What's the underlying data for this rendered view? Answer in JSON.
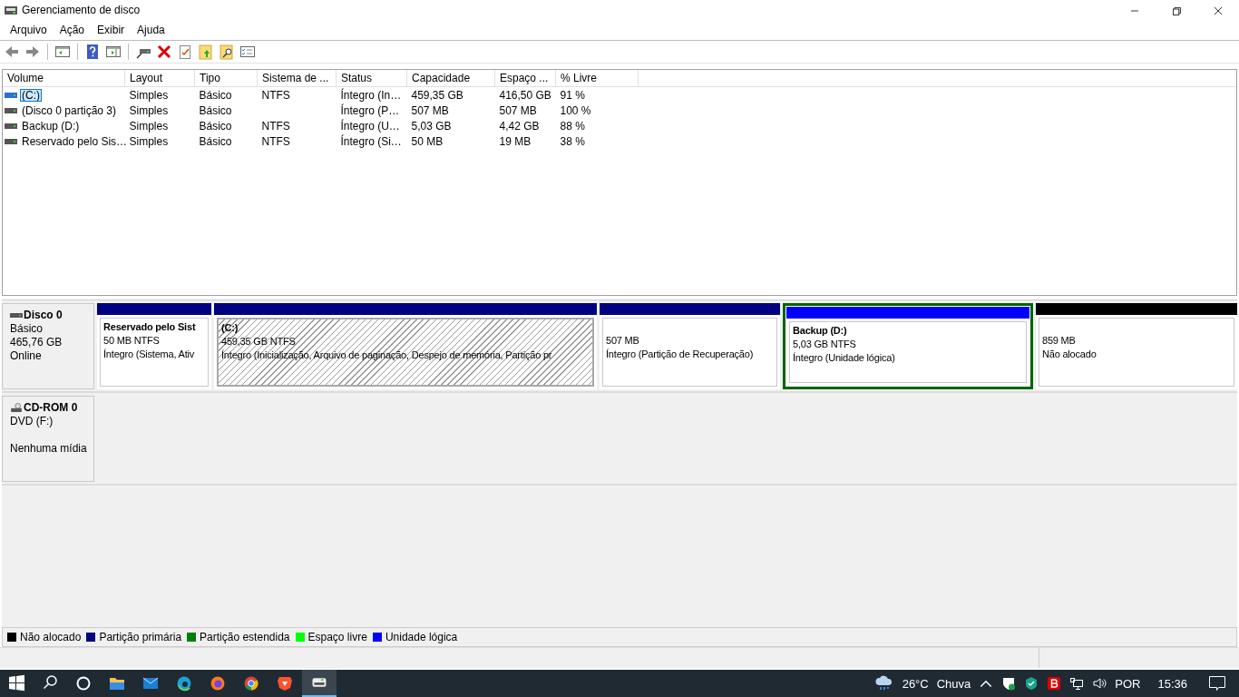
{
  "window": {
    "title": "Gerenciamento de disco"
  },
  "menu": [
    "Arquivo",
    "Ação",
    "Exibir",
    "Ajuda"
  ],
  "table": {
    "columns": [
      "Volume",
      "Layout",
      "Tipo",
      "Sistema de ...",
      "Status",
      "Capacidade",
      "Espaço ...",
      "% Livre"
    ],
    "rows": [
      {
        "selected": true,
        "cells": [
          "(C:)",
          "Simples",
          "Básico",
          "NTFS",
          "Íntegro (In…",
          "459,35 GB",
          "416,50 GB",
          "91 %"
        ]
      },
      {
        "selected": false,
        "cells": [
          "(Disco 0 partição 3)",
          "Simples",
          "Básico",
          "",
          "Íntegro (P…",
          "507 MB",
          "507 MB",
          "100 %"
        ]
      },
      {
        "selected": false,
        "cells": [
          "Backup (D:)",
          "Simples",
          "Básico",
          "NTFS",
          "Íntegro (U…",
          "5,03 GB",
          "4,42 GB",
          "88 %"
        ]
      },
      {
        "selected": false,
        "cells": [
          "Reservado pelo Sis…",
          "Simples",
          "Básico",
          "NTFS",
          "Íntegro (Si…",
          "50 MB",
          "19 MB",
          "38 %"
        ]
      }
    ]
  },
  "disks": [
    {
      "kind": "hdd",
      "name": "Disco 0",
      "lines": [
        "Básico",
        "465,76 GB",
        "Online"
      ],
      "partitions": [
        {
          "name": "Reservado pelo Sist",
          "size": "50 MB NTFS",
          "status": "Íntegro (Sistema, Ativ",
          "color": "#000080",
          "hatched": false,
          "selected": false
        },
        {
          "name": "(C:)",
          "size": "459,35 GB NTFS",
          "status": "Íntegro (Inicialização, Arquivo de paginação, Despejo de memória, Partição pr",
          "color": "#000080",
          "hatched": true,
          "selected": false
        },
        {
          "size": "507 MB",
          "status": "Íntegro (Partição de Recuperação)",
          "color": "#000080",
          "hatched": false,
          "selected": false
        },
        {
          "name": "Backup  (D:)",
          "size": "5,03 GB NTFS",
          "status": "Íntegro (Unidade lógica)",
          "color": "#0000ff",
          "hatched": false,
          "selected": true
        },
        {
          "size": "859 MB",
          "status": "Não alocado",
          "color": "#000000",
          "hatched": false,
          "selected": false
        }
      ]
    },
    {
      "kind": "cdrom",
      "name": "CD-ROM 0",
      "lines": [
        "DVD (F:)"
      ],
      "media_status": "Nenhuma mídia"
    }
  ],
  "legend": [
    {
      "label": "Não alocado",
      "color": "#000000"
    },
    {
      "label": "Partição primária",
      "color": "#000080"
    },
    {
      "label": "Partição estendida",
      "color": "#008000"
    },
    {
      "label": "Espaço livre",
      "color": "#00ff00"
    },
    {
      "label": "Unidade lógica",
      "color": "#0000ff"
    }
  ],
  "taskbar": {
    "weather": {
      "temp": "26°C",
      "text": "Chuva"
    },
    "language": "POR",
    "time": "15:36"
  }
}
